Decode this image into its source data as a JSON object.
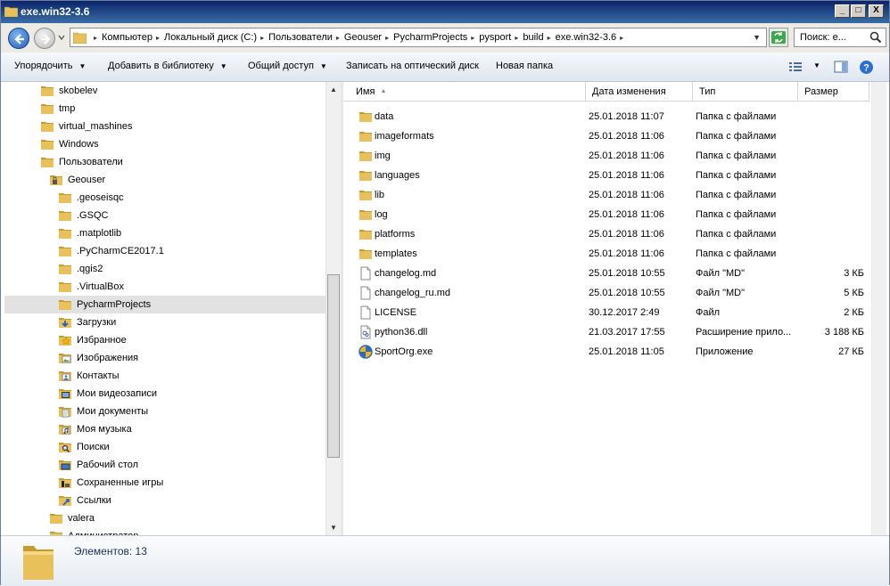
{
  "window": {
    "title": "exe.win32-3.6",
    "controls": {
      "minimize": "_",
      "maximize": "□",
      "close": "X"
    }
  },
  "address_bar": {
    "crumbs": [
      "Компьютер",
      "Локальный диск (C:)",
      "Пользователи",
      "Geouser",
      "PycharmProjects",
      "pysport",
      "build",
      "exe.win32-3.6"
    ],
    "search_placeholder": "Поиск: e..."
  },
  "toolbar": {
    "organize": "Упорядочить",
    "add_to_library": "Добавить в библиотеку",
    "share": "Общий доступ",
    "burn": "Записать на оптический диск",
    "new_folder": "Новая папка"
  },
  "nav_tree": [
    {
      "label": "skobelev",
      "level": 0,
      "icon": "folder"
    },
    {
      "label": "tmp",
      "level": 0,
      "icon": "folder"
    },
    {
      "label": "virtual_mashines",
      "level": 0,
      "icon": "folder"
    },
    {
      "label": "Windows",
      "level": 0,
      "icon": "folder"
    },
    {
      "label": "Пользователи",
      "level": 0,
      "icon": "folder"
    },
    {
      "label": "Geouser",
      "level": 1,
      "icon": "user-folder"
    },
    {
      "label": ".geoseisqc",
      "level": 2,
      "icon": "folder"
    },
    {
      "label": ".GSQC",
      "level": 2,
      "icon": "folder"
    },
    {
      "label": ".matplotlib",
      "level": 2,
      "icon": "folder"
    },
    {
      "label": ".PyCharmCE2017.1",
      "level": 2,
      "icon": "folder"
    },
    {
      "label": ".qgis2",
      "level": 2,
      "icon": "folder"
    },
    {
      "label": ".VirtualBox",
      "level": 2,
      "icon": "folder"
    },
    {
      "label": "PycharmProjects",
      "level": 2,
      "icon": "folder",
      "selected": true
    },
    {
      "label": "Загрузки",
      "level": 2,
      "icon": "downloads"
    },
    {
      "label": "Избранное",
      "level": 2,
      "icon": "favorites"
    },
    {
      "label": "Изображения",
      "level": 2,
      "icon": "pictures"
    },
    {
      "label": "Контакты",
      "level": 2,
      "icon": "contacts"
    },
    {
      "label": "Мои видеозаписи",
      "level": 2,
      "icon": "videos"
    },
    {
      "label": "Мои документы",
      "level": 2,
      "icon": "documents"
    },
    {
      "label": "Моя музыка",
      "level": 2,
      "icon": "music"
    },
    {
      "label": "Поиски",
      "level": 2,
      "icon": "searches"
    },
    {
      "label": "Рабочий стол",
      "level": 2,
      "icon": "desktop"
    },
    {
      "label": "Сохраненные игры",
      "level": 2,
      "icon": "saved-games"
    },
    {
      "label": "Ссылки",
      "level": 2,
      "icon": "links"
    },
    {
      "label": "valera",
      "level": 1,
      "icon": "folder"
    },
    {
      "label": "Администратор",
      "level": 1,
      "icon": "folder"
    }
  ],
  "columns": {
    "name": "Имя",
    "date": "Дата изменения",
    "type": "Тип",
    "size": "Размер"
  },
  "files": [
    {
      "name": "data",
      "date": "25.01.2018 11:07",
      "type": "Папка с файлами",
      "size": "",
      "icon": "folder"
    },
    {
      "name": "imageformats",
      "date": "25.01.2018 11:06",
      "type": "Папка с файлами",
      "size": "",
      "icon": "folder"
    },
    {
      "name": "img",
      "date": "25.01.2018 11:06",
      "type": "Папка с файлами",
      "size": "",
      "icon": "folder"
    },
    {
      "name": "languages",
      "date": "25.01.2018 11:06",
      "type": "Папка с файлами",
      "size": "",
      "icon": "folder"
    },
    {
      "name": "lib",
      "date": "25.01.2018 11:06",
      "type": "Папка с файлами",
      "size": "",
      "icon": "folder"
    },
    {
      "name": "log",
      "date": "25.01.2018 11:06",
      "type": "Папка с файлами",
      "size": "",
      "icon": "folder"
    },
    {
      "name": "platforms",
      "date": "25.01.2018 11:06",
      "type": "Папка с файлами",
      "size": "",
      "icon": "folder"
    },
    {
      "name": "templates",
      "date": "25.01.2018 11:06",
      "type": "Папка с файлами",
      "size": "",
      "icon": "folder"
    },
    {
      "name": "changelog.md",
      "date": "25.01.2018 10:55",
      "type": "Файл \"MD\"",
      "size": "3 КБ",
      "icon": "file"
    },
    {
      "name": "changelog_ru.md",
      "date": "25.01.2018 10:55",
      "type": "Файл \"MD\"",
      "size": "5 КБ",
      "icon": "file"
    },
    {
      "name": "LICENSE",
      "date": "30.12.2017 2:49",
      "type": "Файл",
      "size": "2 КБ",
      "icon": "file"
    },
    {
      "name": "python36.dll",
      "date": "21.03.2017 17:55",
      "type": "Расширение прило...",
      "size": "3 188 КБ",
      "icon": "dll"
    },
    {
      "name": "SportOrg.exe",
      "date": "25.01.2018 11:05",
      "type": "Приложение",
      "size": "27 КБ",
      "icon": "app"
    }
  ],
  "status": {
    "count_label": "Элементов: 13"
  },
  "colors": {
    "folder": "#e8c15a",
    "folder_dark": "#c89a2a",
    "title_bar": "#0a246a",
    "selection": "#e2e2e2"
  }
}
